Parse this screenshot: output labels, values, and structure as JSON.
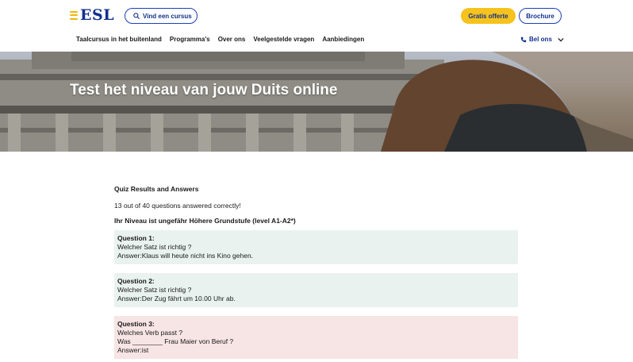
{
  "header": {
    "logo_text": "ESL",
    "search_label": "Vind een cursus",
    "offer_label": "Gratis offerte",
    "brochure_label": "Brochure",
    "brand_color": "#10308e",
    "accent_color": "#f6c21d"
  },
  "nav": {
    "items": [
      {
        "label": "Taalcursus in het buitenland"
      },
      {
        "label": "Programma's"
      },
      {
        "label": "Over ons"
      },
      {
        "label": "Veelgestelde vragen"
      },
      {
        "label": "Aanbiedingen"
      }
    ],
    "call_label": "Bel ons"
  },
  "hero": {
    "title": "Test het niveau van jouw Duits online"
  },
  "results": {
    "heading": "Quiz Results and Answers",
    "summary": "13 out of 40 questions answered correctly!",
    "level": "Ihr Niveau ist ungefähr Höhere Grundstufe (level A1-A2*)",
    "questions": [
      {
        "title": "Question 1:",
        "prompt": "Welcher Satz ist richtig ?",
        "answer": "Answer:Klaus will heute nicht ins Kino gehen.",
        "status": "correct"
      },
      {
        "title": "Question 2:",
        "prompt": "Welcher Satz ist richtig ?",
        "answer": "Answer:Der Zug fährt um 10.00 Uhr ab.",
        "status": "correct"
      },
      {
        "title": "Question 3:",
        "prompt": "Welches Verb passt ?",
        "prompt2": "Was ________ Frau Maier von Beruf ?",
        "answer": "Answer:ist",
        "status": "incorrect"
      }
    ],
    "colors": {
      "correct": "#e9f2ef",
      "incorrect": "#f7e4e4"
    }
  }
}
